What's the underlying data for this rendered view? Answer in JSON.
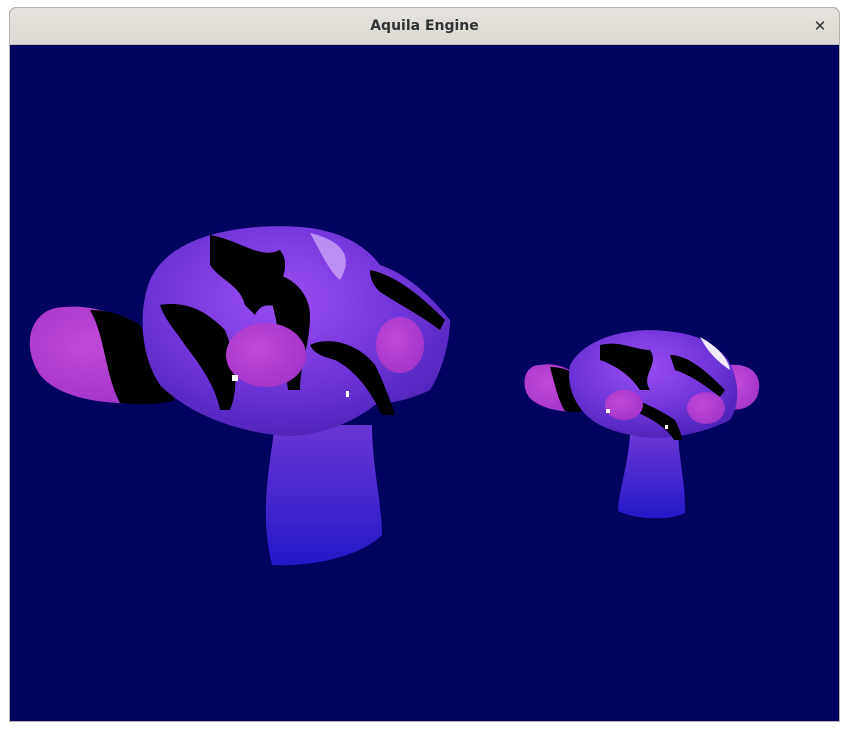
{
  "window": {
    "title": "Aquila Engine",
    "close_glyph": "✕",
    "close_icon": "close-icon"
  },
  "scene": {
    "clear_color": "#02025f",
    "model_body_color": "#7a3ae0",
    "model_ear_color": "#b23cd0",
    "stripe_color": "#000000",
    "model_count": 2
  }
}
